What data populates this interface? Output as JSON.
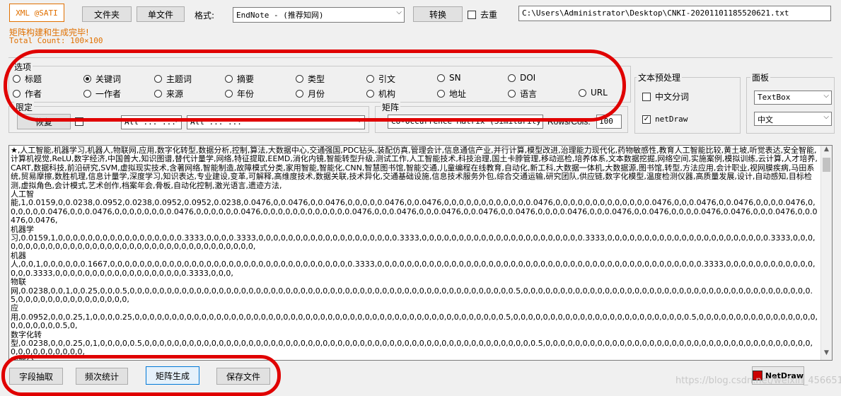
{
  "toolbar": {
    "brand_label": "XML @SATI",
    "folder_button": "文件夹",
    "single_file_button": "单文件",
    "format_label": "格式:",
    "format_value": "EndNote  - (推荐知网)",
    "convert_button": "转换",
    "dedupe_label": "去重",
    "file_path": "C:\\Users\\Administrator\\Desktop\\CNKI-20201101185520621.txt"
  },
  "status": {
    "line1": "矩阵构建和生成完毕!",
    "line2": "Total Count: 100×100"
  },
  "options": {
    "legend": "选项",
    "row1": [
      {
        "label": "标题",
        "selected": false
      },
      {
        "label": "关键词",
        "selected": true
      },
      {
        "label": "主题词",
        "selected": false
      },
      {
        "label": "摘要",
        "selected": false
      },
      {
        "label": "类型",
        "selected": false
      },
      {
        "label": "引文",
        "selected": false
      },
      {
        "label": "SN",
        "selected": false
      },
      {
        "label": "DOI",
        "selected": false
      }
    ],
    "row2": [
      {
        "label": "作者",
        "selected": false
      },
      {
        "label": "一作者",
        "selected": false
      },
      {
        "label": "来源",
        "selected": false
      },
      {
        "label": "年份",
        "selected": false
      },
      {
        "label": "月份",
        "selected": false
      },
      {
        "label": "机构",
        "selected": false
      },
      {
        "label": "地址",
        "selected": false
      },
      {
        "label": "语言",
        "selected": false
      },
      {
        "label": "URL",
        "selected": false
      }
    ]
  },
  "text_pre": {
    "legend": "文本预处理",
    "zh_seg": "中文分词",
    "netdraw": "netDraw",
    "zh_seg_checked": false,
    "netdraw_checked": true
  },
  "panel": {
    "legend": "面板",
    "type_value": "TextBox",
    "lang_value": "中文"
  },
  "limit": {
    "legend": "限定",
    "restore_button": "恢复",
    "combo1": "All ... ...",
    "combo2": "All ... ..."
  },
  "matrix": {
    "legend": "矩阵",
    "type_value": "Co-Occurrence Matrix (Similarity)",
    "rows_label": "Rows/Cols:",
    "rows_value": "100"
  },
  "output_text": "★,人工智能,机器学习,机器人,物联网,应用,数字化转型,数据分析,控制,算法,大数据中心,交通强国,PDC钻头,装配仿真,管理会计,信息通信产业,并行计算,模型改进,治理能力现代化,药物敏感性,教育人工智能比较,黄土坡,听觉表达,安全智能,计算机视觉,ReLU,数字经济,中国普大,知识图谱,替代计量学,网络,特征提取,EEMD,消化内镜,智能转型升级,测试工作,人工智能技术,科技治理,国土卡脖管理,移动巡检,培养体系,文本数据挖掘,网络空间,实施案例,模拟训练,云计算,人才培养,CART,数据科技,前沿研究,SVM,虚拟现实技术,含著网络,智能制造,故障模式分类,家用智能,智能化,CNN,智慧图书馆,智能交通,儿童编程在线教育,自动化,新工科,大数据一体机,大数据源,图书馆,转型,方法应用,会计职业,视网膜疾病,马田系统,贸易摩擦,数胜机理,信息计量学,深度学习,知识表达,专业建设,变革,可解释,高维度技术,数据关联,技术异化,交通基础设施,信息技术服务外包,综合交通运输,研究团队,供应链,数字化模型,温度检测仪器,高质量发展,设计,自动感知,目标检测,虚拟角色,会计模式,艺术创作,档案年会,骨板,自动化控制,激光语言,遗迹方法,\n人工智\n能,1,0.0159,0,0.0238,0.0952,0.0238,0.0952,0.0952,0.0238,0.0476,0,0.0476,0,0.0476,0,0,0,0,0.0476,0,0.0476,0,0,0,0,0,0,0,0,0,0,0,0.0476,0,0,0,0,0,0,0,0,0,0,0,0,0.0476,0,0,0.0476,0,0.0476,0,0,0,0.0476,0,0,0,0,0,0.0476,0,0,0.0476,0,0,0,0,0,0,0,0.0476,0,0,0,0,0,0.0476,0,0,0,0,0,0,0,0,0,0,0,0.0476,0,0,0.0476,0,0,0.0476,0,0.0476,0,0.0476,0,0,0,0.0476,0,0,0.0476,0,0.0476,0,0,0,0.0476,0.0476,0,0,0.0476,0,0.0476,0.0476,\n机器学\n习,0.0159,1,0,0,0,0,0,0,0,0,0,0,0,0,0,0,0,0,0.3333,0,0,0,0.3333,0,0,0,0,0,0,0,0,0,0,0,0,0,0,0,0,0,0,0.3333,0,0,0,0,0,0,0,0,0,0,0,0,0,0,0,0,0,0,0,0,0,0.3333,0,0,0,0,0,0,0,0,0,0,0,0,0,0,0,0,0,0,0,0,0,0.3333,0,0,0,0,0,0,0,0,0,0,0,0,0,0,0,0,0,0,0,0,0,0,0,0,0,0,0,0,0,0,0,0,0,0,0,0,\n机器\n人,0,0,1,0,0,0,0,0,0.1667,0,0,0,0,0,0,0,0,0,0,0,0,0,0,0,0,0,0,0,0,0,0,0,0,0,0,0,0,0,0,0,0,0.3333,0,0,0,0,0,0,0,0,0,0,0,0,0,0,0,0,0,0,0,0,0,0,0,0,0,0,0,0,0,0,0,0,0,0,0,0,0,0,0,0,0,0,0,0.3333,0,0,0,0,0,0,0,0,0,0,0,0,0,0,0.3333,0,0,0,0,0,0,0,0,0,0,0,0,0,0,0,0,0,0.3333,0,0,0,\n物联\n网,0.0238,0,0,1,0,0.25,0,0,0.5,0,0,0,0,0,0,0,0,0,0,0,0,0,0,0,0,0,0,0,0,0,0,0,0,0,0,0,0,0,0,0,0,0,0,0,0,0,0,0,0,0,0,0,0,0,0,0,0,0,0,0,0.5,0,0,0,0,0,0,0,0,0,0,0,0,0,0,0,0,0,0,0,0,0,0,0,0,0,0,0,0,0,0,0,0,0,0,0,0,0,0,0.5,0,0,0,0,0,0,0,0,0,0,0,0,0,0,0,\n应\n用,0.0952,0,0,0.25,1,0,0,0,0.25,0,0,0,0,0,0,0,0,0,0,0,0,0,0,0,0,0,0,0,0,0,0,0,0,0,0,0,0,0,0,0,0,0,0,0,0,0,0,0,0,0,0,0,0,0,0,0,0,0,0.5,0,0,0,0,0,0,0,0,0,0,0,0,0,0,0,0,0,0,0,0,0,0,0,0.5,0,0,0,0,0,0,0,0,0,0,0,0,0,0,0,0,0,0,0,0,0,0,0.5,0,\n数字化转\n型,0.0238,0,0,0.25,0,1,0,0,0,0,0.5,0,0,0,0,0,0,0,0,0,0,0,0,0,0,0,0,0,0,0,0,0,0,0,0,0,0,0,0,0,0,0,0,0,0,0,0,0,0,0,0,0,0,0,0,0,0,0,0,0,0,0,0,0.5,0,0,0,0,0,0,0,0,0,0,0,0,0,0,0,0,0,0,0,0,0,0,0,0,0,0,0,0,0,0,0,0,0,0,0,0,0,0,0,0,0,0,0,0,0,0,\n数据分\n析,0.0952,0,0,0,0,0,1,0,0,0,0,0,0,0,0,0,0,0,0,0,0,0,0,0,0,0,0,0,0,0,0,0,0,0,0,0,0,0,0,0,0,0,0,0,0,0,0,0,0,0,0,0,0,0,0,0,0,0,0,0,0,0,0,0,0,0.5,0,0,0,0,0,0,0,0,0,0,0,0,0,0,0,0,0,0,0,0,0,0,0,0,0,0,0,0,0,0,0,0,0,",
  "bottom": {
    "field_extract": "字段抽取",
    "freq_stats": "频次统计",
    "matrix_gen": "矩阵生成",
    "save_file": "保存文件",
    "netdraw_btn": "NetDraw",
    "watermark": "https://blog.csdn.net/weixin_45665135"
  }
}
